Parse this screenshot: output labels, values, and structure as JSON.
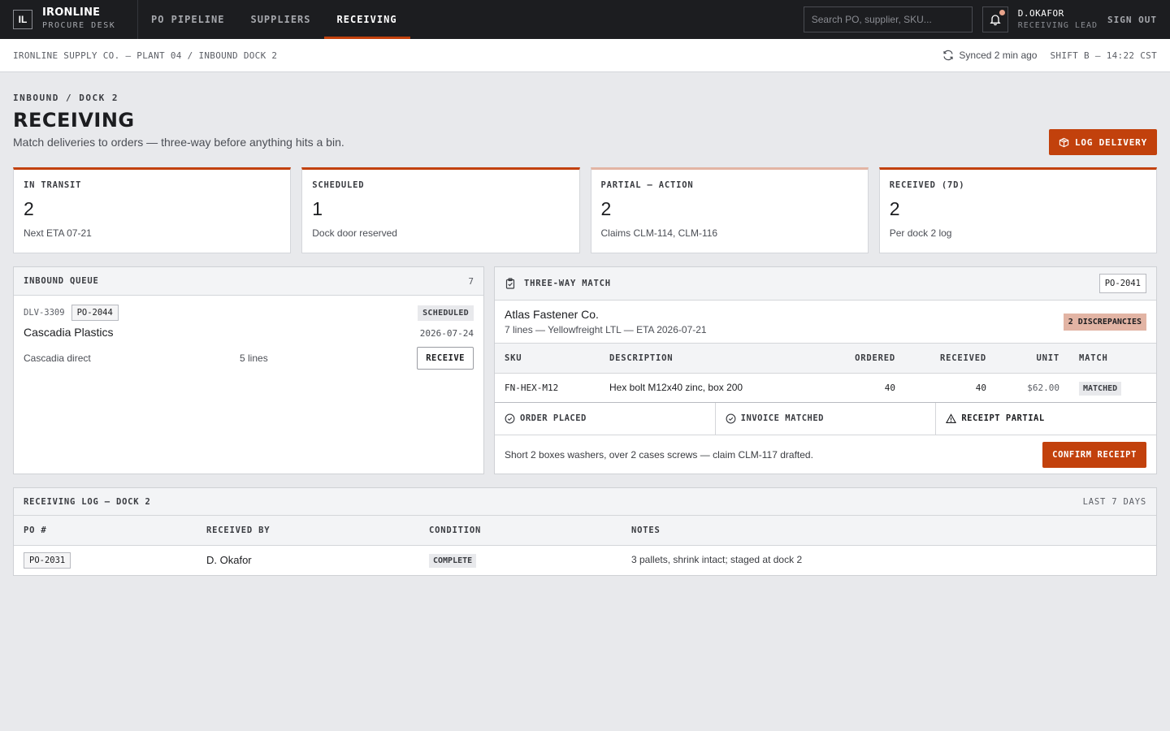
{
  "brand": {
    "mark": "IL",
    "name": "IRONLINE",
    "subtitle": "PROCURE DESK"
  },
  "nav": {
    "tabs": [
      {
        "label": "PO PIPELINE"
      },
      {
        "label": "SUPPLIERS"
      },
      {
        "label": "RECEIVING",
        "active": true
      }
    ]
  },
  "search": {
    "placeholder": "Search PO, supplier, SKU..."
  },
  "user": {
    "name": "D.OKAFOR",
    "role": "RECEIVING LEAD"
  },
  "signout": "SIGN OUT",
  "subbar": {
    "breadcrumb": "IRONLINE SUPPLY CO. — PLANT 04 / INBOUND DOCK 2",
    "sync": "Synced 2 min ago",
    "shift": "SHIFT B — 14:22 CST"
  },
  "page": {
    "eyebrow": "INBOUND / DOCK 2",
    "title": "RECEIVING",
    "subtitle": "Match deliveries to orders — three-way before anything hits a bin.",
    "log_delivery": "LOG DELIVERY"
  },
  "stats": [
    {
      "label": "IN TRANSIT",
      "value": "2",
      "note": "Next ETA 07-21"
    },
    {
      "label": "SCHEDULED",
      "value": "1",
      "note": "Dock door reserved"
    },
    {
      "label": "PARTIAL — ACTION",
      "value": "2",
      "note": "Claims CLM-114, CLM-116"
    },
    {
      "label": "RECEIVED (7D)",
      "value": "2",
      "note": "Per dock 2 log"
    }
  ],
  "queue": {
    "title": "INBOUND QUEUE",
    "count": "7",
    "items": [
      {
        "id": "DLV-3309",
        "po": "PO-2044",
        "status": "SCHEDULED",
        "supplier": "Cascadia Plastics",
        "date": "2026-07-24",
        "carrier": "Cascadia direct",
        "lines": "5 lines",
        "action": "RECEIVE"
      }
    ]
  },
  "match": {
    "title": "THREE-WAY MATCH",
    "po": "PO-2041",
    "supplier": "Atlas Fastener Co.",
    "meta": "7 lines — Yellowfreight LTL — ETA 2026-07-21",
    "discrepancies": "2 DISCREPANCIES",
    "columns": {
      "sku": "SKU",
      "description": "DESCRIPTION",
      "ordered": "ORDERED",
      "received": "RECEIVED",
      "unit": "UNIT",
      "match": "MATCH"
    },
    "rows": [
      {
        "sku": "FN-HEX-M12",
        "description": "Hex bolt M12x40 zinc, box 200",
        "ordered": "40",
        "received": "40",
        "unit": "$62.00",
        "match": "MATCHED"
      }
    ],
    "steps": [
      {
        "label": "ORDER PLACED",
        "icon": "check-circle-icon"
      },
      {
        "label": "INVOICE MATCHED",
        "icon": "check-circle-icon"
      },
      {
        "label": "RECEIPT PARTIAL",
        "icon": "warning-icon"
      }
    ],
    "note": "Short 2 boxes washers, over 2 cases screws — claim CLM-117 drafted.",
    "confirm": "CONFIRM RECEIPT"
  },
  "log": {
    "title": "RECEIVING LOG — DOCK 2",
    "range": "LAST 7 DAYS",
    "columns": {
      "po": "PO #",
      "received_by": "RECEIVED BY",
      "condition": "CONDITION",
      "notes": "NOTES"
    },
    "rows": [
      {
        "po": "PO-2031",
        "received_by": "D. Okafor",
        "condition": "COMPLETE",
        "notes": "3 pallets, shrink intact; staged at dock 2"
      }
    ]
  },
  "colors": {
    "accent": "#c2410c",
    "discrepancy": "#e2b4a4",
    "topbar": "#1c1d20"
  }
}
